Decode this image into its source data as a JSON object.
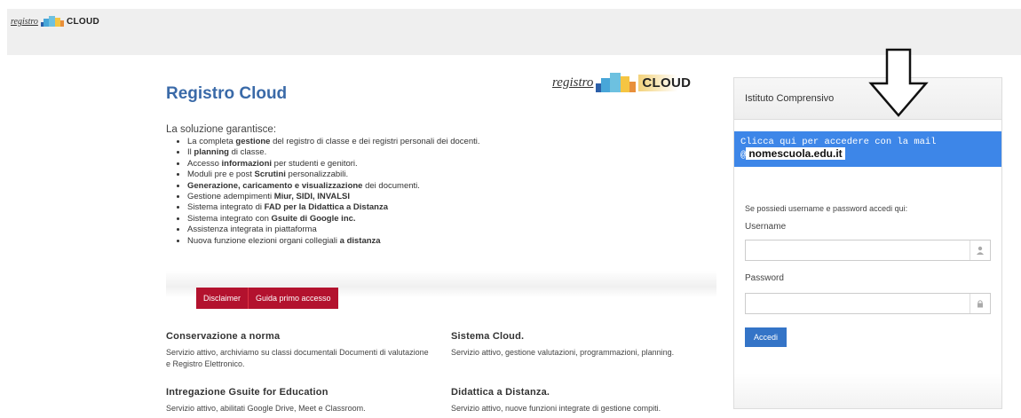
{
  "logo": {
    "script": "registro",
    "word": "CLOUD"
  },
  "main": {
    "title": "Registro Cloud",
    "intro": "La soluzione garantisce:",
    "features": [
      {
        "pre": "La completa ",
        "bold": "gestione",
        "post": " del registro di classe e dei registri personali dei docenti."
      },
      {
        "pre": "Il ",
        "bold": "planning",
        "post": " di classe."
      },
      {
        "pre": "Accesso ",
        "bold": "informazioni",
        "post": " per studenti e genitori."
      },
      {
        "pre": "Moduli pre e post ",
        "bold": "Scrutini",
        "post": " personalizzabili."
      },
      {
        "pre": "",
        "bold": "Generazione, caricamento e visualizzazione",
        "post": " dei documenti."
      },
      {
        "pre": "Gestione adempimenti ",
        "bold": "Miur, SIDI, INVALSI",
        "post": ""
      },
      {
        "pre": "Sistema integrato di ",
        "bold": "FAD per la Didattica a Distanza",
        "post": ""
      },
      {
        "pre": "Sistema integrato con ",
        "bold": "Gsuite di Google inc.",
        "post": ""
      },
      {
        "pre": "Assistenza integrata in piattaforma",
        "bold": "",
        "post": ""
      },
      {
        "pre": "Nuova funzione elezioni organi collegiali ",
        "bold": "a distanza",
        "post": ""
      }
    ],
    "buttons": {
      "disclaimer": "Disclaimer",
      "guide": "Guida primo accesso"
    }
  },
  "sections": {
    "conservazione": {
      "title": "Conservazione a norma",
      "text": "Servizio attivo, archiviamo su classi documentali Documenti di valutazione e Registro Elettronico."
    },
    "cloud": {
      "title": "Sistema Cloud.",
      "text": "Servizio attivo, gestione valutazioni, programmazioni, planning."
    },
    "gsuite": {
      "title": "Intregazione Gsuite for Education",
      "text": "Servizio attivo, abilitati Google Drive, Meet e Classroom."
    },
    "dad": {
      "title": "Didattica a Distanza.",
      "text": "Servizio attivo, nuove funzioni integrate di gestione compiti."
    }
  },
  "login": {
    "header": "Istituto Comprensivo",
    "mail_text": "Clicca qui per accedere con la mail",
    "mail_prefix": "@",
    "mail_domain": "nomescuola.edu.it",
    "note": "Se possiedi username e password accedi qui:",
    "username_label": "Username",
    "password_label": "Password",
    "submit": "Accedi",
    "username_icon": "user-icon",
    "password_icon": "lock-icon"
  },
  "colors": {
    "accent_red": "#b3122e",
    "accent_blue": "#3d86e8",
    "title_blue": "#3a6aa8"
  }
}
